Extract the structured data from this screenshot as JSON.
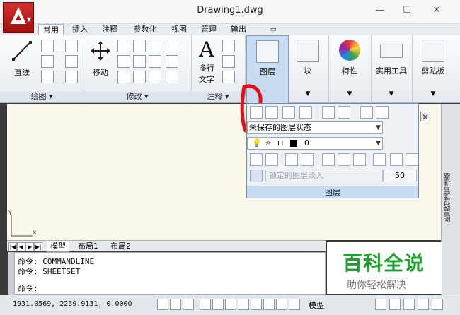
{
  "window": {
    "title": "Drawing1.dwg",
    "minimize": "—",
    "maximize": "☐",
    "close": "✕"
  },
  "tabs": [
    {
      "label": "常用",
      "active": true
    },
    {
      "label": "插入"
    },
    {
      "label": "注释"
    },
    {
      "label": "参数化"
    },
    {
      "label": "视图"
    },
    {
      "label": "管理"
    },
    {
      "label": "输出"
    }
  ],
  "ribbon": {
    "line_label": "直线",
    "move_label": "移动",
    "mtext_label": "多行\n文字",
    "mtext_line1": "多行",
    "mtext_line2": "文字",
    "layer_label": "图层",
    "block_label": "块",
    "props_label": "特性",
    "utilities_label": "实用工具",
    "clipboard_label": "剪贴板",
    "panel_draw": "绘图 ▾",
    "panel_modify": "修改 ▾",
    "panel_annot": "注释 ▾"
  },
  "layer_panel": {
    "state_combo": "未保存的图层状态",
    "current_layer": "0",
    "lock_fade_label": "锁定的图层淡入",
    "lock_fade_value": "50",
    "footer": "图层",
    "close": "✕"
  },
  "side_palette": "图层特性管理器",
  "layout_tabs": [
    "模型",
    "布局1",
    "布局2"
  ],
  "command": {
    "lines": [
      "命令: COMMANDLINE",
      "命令: SHEETSET"
    ],
    "prompt": "命令:"
  },
  "status": {
    "coords": "1931.0569, 2239.9131, 0.0000",
    "model": "模型"
  },
  "watermark": {
    "big": "百科全说",
    "small": "助你轻松解决"
  },
  "colors": {
    "accent": "#c01818",
    "drawing_bg": "#fbf8ec",
    "watermark_green": "#1fa12e"
  }
}
